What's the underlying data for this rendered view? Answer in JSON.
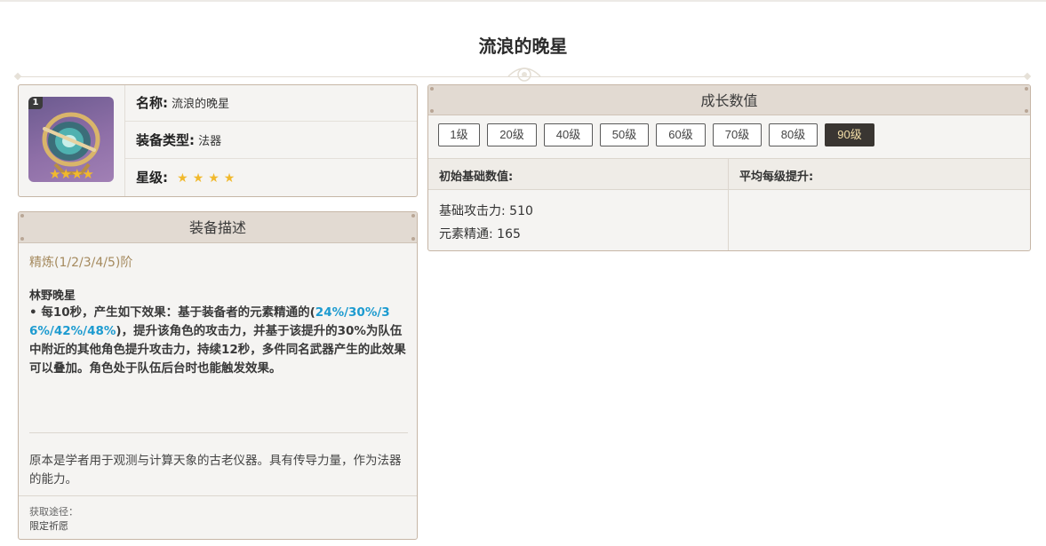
{
  "page": {
    "title": "流浪的晚星"
  },
  "weapon": {
    "refinement_badge": "1",
    "thumb_stars": "★★★★",
    "name_label": "名称:",
    "name_value": "流浪的晚星",
    "type_label": "装备类型:",
    "type_value": "法器",
    "rarity_label": "星级:",
    "rarity_stars": "★★★★",
    "rarity": 4
  },
  "description": {
    "header": "装备描述",
    "refine_title": "精炼(1/2/3/4/5)阶",
    "effect_name": "林野晚星",
    "effect_prefix": "• 每10秒，产生如下效果：基于装备者的元素精通的(",
    "effect_highlight": "24%/30%/36%/42%/48%",
    "effect_suffix": ")，提升该角色的攻击力，并基于该提升的30%为队伍中附近的其他角色提升攻击力，持续12秒，多件同名武器产生的此效果可以叠加。角色处于队伍后台时也能触发效果。",
    "lore": "原本是学者用于观测与计算天象的古老仪器。具有传导力量，作为法器的能力。",
    "source_label": "获取途径：",
    "source_value": "限定祈愿"
  },
  "growth": {
    "header": "成长数值",
    "levels": [
      "1级",
      "20级",
      "40级",
      "50级",
      "60级",
      "70级",
      "80级",
      "90级"
    ],
    "active_level": "90级",
    "base_header": "初始基础数值:",
    "avg_header": "平均每级提升:",
    "stats": [
      "基础攻击力: 510",
      "元素精通: 165"
    ]
  },
  "colors": {
    "accent_gold": "#a58a5e",
    "highlight_blue": "#1d9bd0",
    "star_yellow": "#f1b92d",
    "active_level_bg": "#3a3632"
  }
}
